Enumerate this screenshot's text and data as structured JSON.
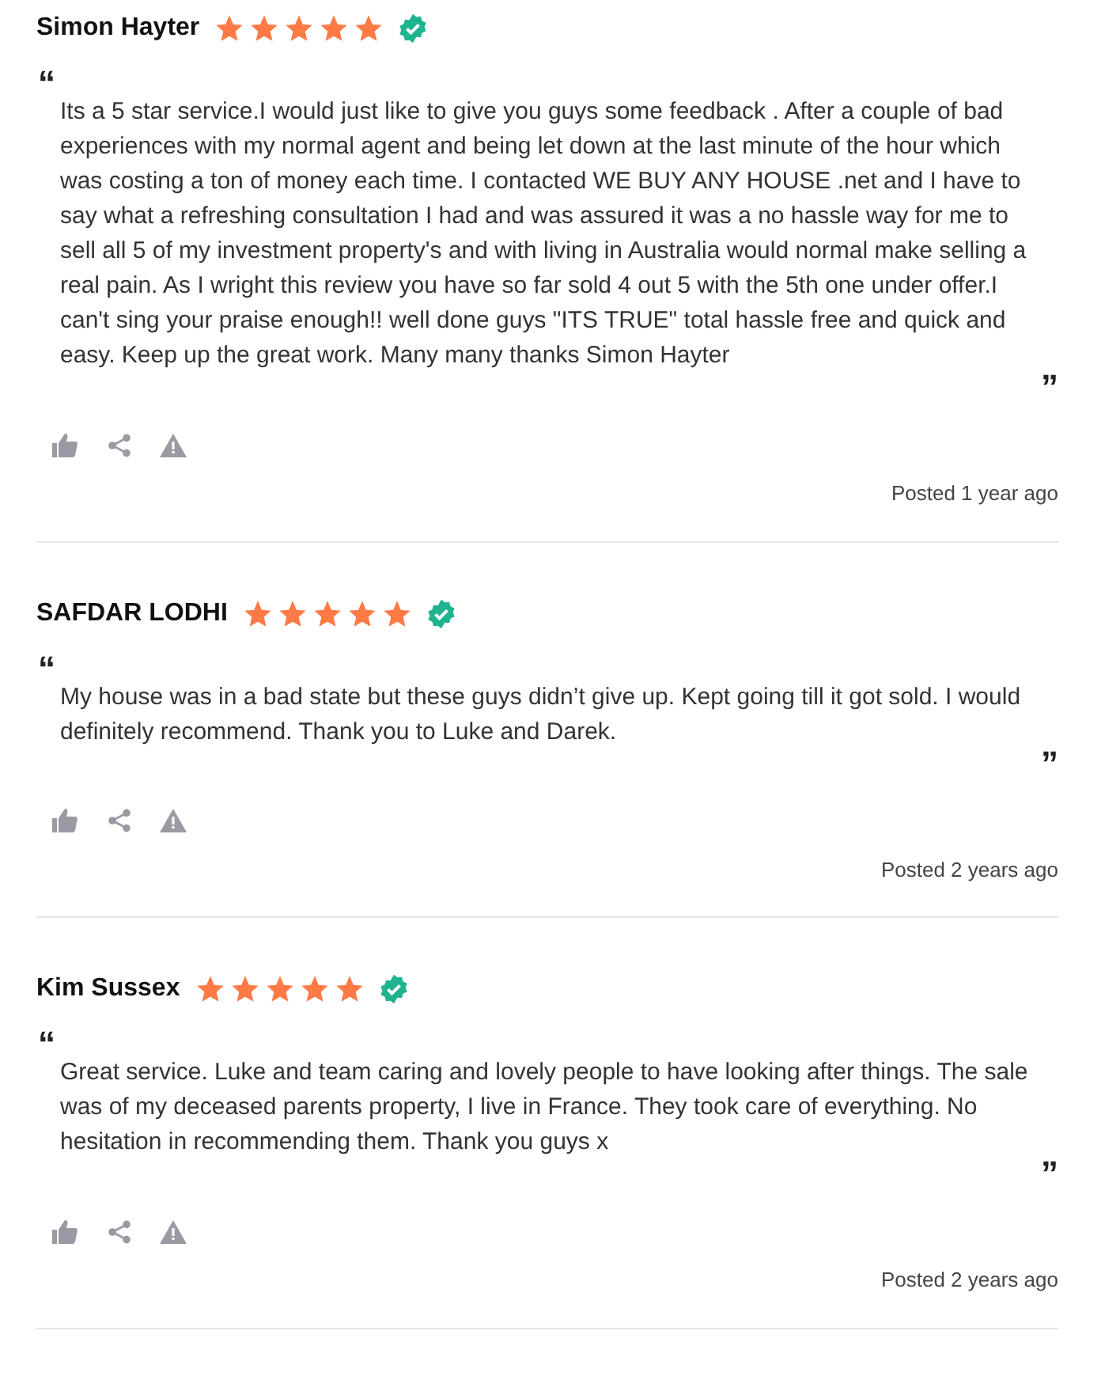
{
  "reviews": [
    {
      "name": "Simon Hayter",
      "stars": 5,
      "verified": true,
      "open_quote": "“",
      "text": "Its a 5 star service.I would just like to give you guys some feedback . After a couple of bad experiences with my normal agent and being let down at the last minute of the hour which was costing a ton of money each time. I contacted WE BUY ANY HOUSE .net and I have to say what a refreshing consultation I had and was assured it was a no hassle way for me to sell all 5 of my investment property's and with living in Australia would normal make selling a real pain. As I wright this review you have so far sold 4 out 5 with the 5th one under offer.I can't sing your praise enough!! well done guys \"ITS TRUE\" total hassle free and quick and easy. Keep up the great work. Many many thanks Simon Hayter",
      "close_quote": "”",
      "posted": "Posted 1 year ago"
    },
    {
      "name": "SAFDAR LODHI",
      "stars": 5,
      "verified": true,
      "open_quote": "“",
      "text": "My house was in a bad state but these guys didn’t give up. Kept going till it got sold. I would definitely recommend. Thank you to Luke and Darek.",
      "close_quote": "”",
      "posted": "Posted 2 years ago"
    },
    {
      "name": "Kim Sussex",
      "stars": 5,
      "verified": true,
      "open_quote": "“",
      "text": "Great service. Luke and team caring and lovely people to have looking after things. The sale was of my deceased parents property, I live in France. They took care of everything. No hesitation in recommending them. Thank you guys x",
      "close_quote": "”",
      "posted": "Posted 2 years ago"
    }
  ]
}
